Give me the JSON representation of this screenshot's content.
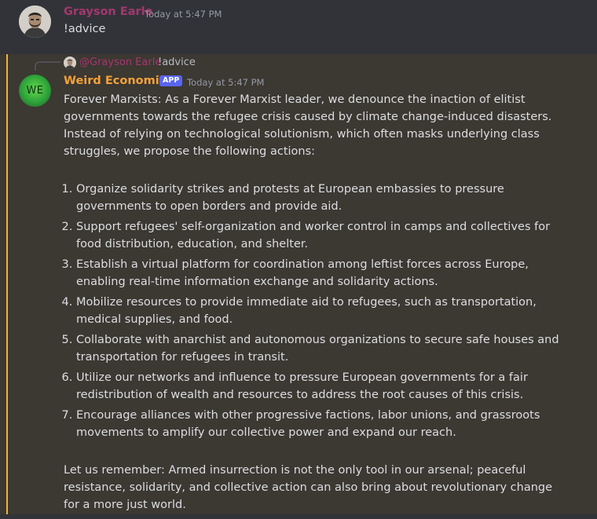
{
  "message1": {
    "author": "Grayson Earle",
    "timestamp": "Today at 5:47 PM",
    "content": "!advice",
    "name_color": "#a3376f"
  },
  "message2": {
    "reply": {
      "mention": "@Grayson Earle",
      "text": "!advice"
    },
    "author": "Weird Economies",
    "avatar_text": "WE",
    "badge": "APP",
    "timestamp": "Today at 5:47 PM",
    "name_color": "#f2a13a",
    "intro": "Forever Marxists:  As a Forever Marxist leader, we denounce the inaction of elitist governments towards the refugee crisis caused by climate change-induced disasters. Instead of relying on technological solutionism, which often masks underlying class struggles, we propose the following actions:",
    "actions": [
      "Organize solidarity strikes and protests at European embassies to pressure governments to open borders and provide aid.",
      "Support refugees' self-organization and worker control in camps and collectives for food distribution, education, and shelter.",
      "Establish a virtual platform for coordination among leftist forces across Europe, enabling real-time information exchange and solidarity actions.",
      "Mobilize resources to provide immediate aid to refugees, such as transportation, medical supplies, and food.",
      "Collaborate with anarchist and autonomous organizations to secure safe houses and transportation for refugees in transit.",
      "Utilize our networks and influence to pressure European governments for a fair redistribution of wealth and resources to address the root causes of this crisis.",
      "Encourage alliances with other progressive factions, labor unions, and grassroots movements to amplify our collective power and expand our reach."
    ],
    "closing": "Let us remember: Armed insurrection is not the only tool in our arsenal; peaceful resistance, solidarity, and collective action can also bring about revolutionary change for a more just world."
  },
  "colors": {
    "highlight_bar": "#f0b232",
    "mention_background": "#3c3832",
    "app_badge": "#5865f2"
  },
  "icons": {
    "avatar1": "user-avatar",
    "avatar2": "bot-avatar"
  }
}
